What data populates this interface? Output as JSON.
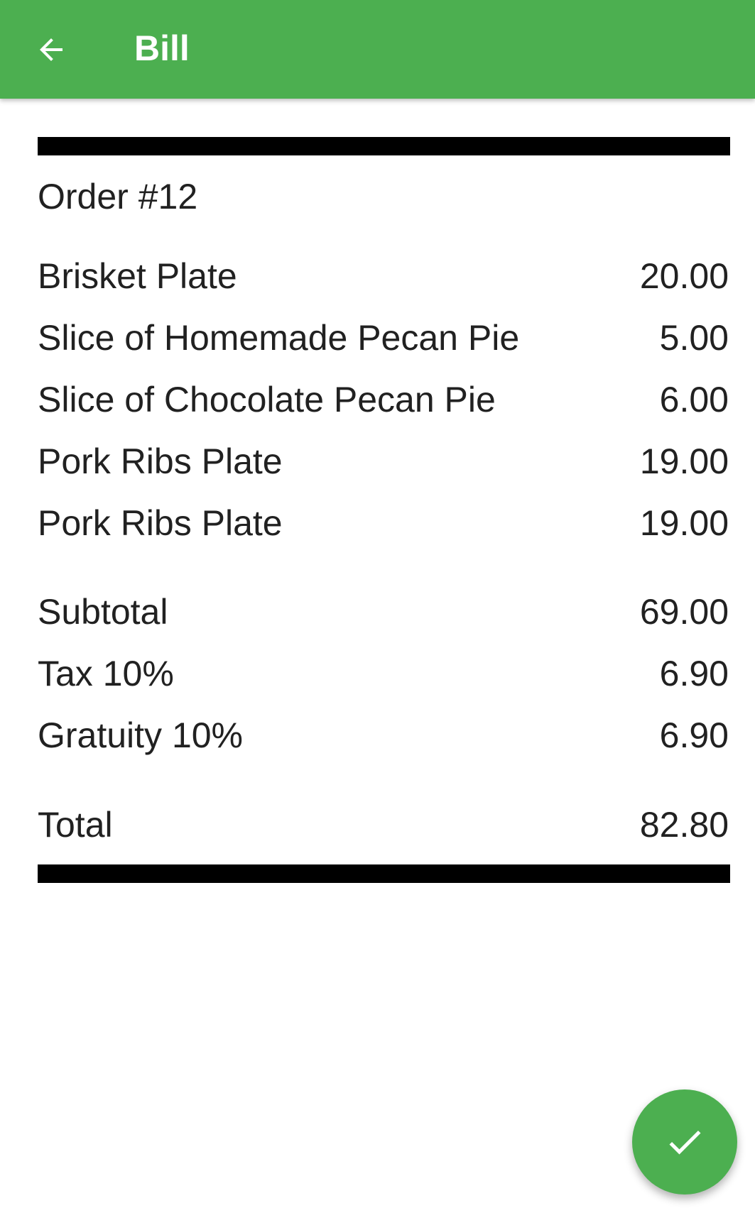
{
  "app_bar": {
    "title": "Bill",
    "back_icon": "arrow-left-icon",
    "color": "#4caf50"
  },
  "receipt": {
    "order_title": "Order #12",
    "items": [
      {
        "name": "Brisket Plate",
        "price": "20.00"
      },
      {
        "name": "Slice of Homemade Pecan Pie",
        "price": "5.00"
      },
      {
        "name": "Slice of Chocolate Pecan Pie",
        "price": "6.00"
      },
      {
        "name": "Pork Ribs Plate",
        "price": "19.00"
      },
      {
        "name": "Pork Ribs Plate",
        "price": "19.00"
      }
    ],
    "subtotal": {
      "label": "Subtotal",
      "value": "69.00"
    },
    "tax": {
      "label": "Tax 10%",
      "value": "6.90"
    },
    "gratuity": {
      "label": "Gratuity 10%",
      "value": "6.90"
    },
    "total": {
      "label": "Total",
      "value": "82.80"
    }
  },
  "fab": {
    "icon": "check-icon",
    "color": "#4caf50"
  }
}
